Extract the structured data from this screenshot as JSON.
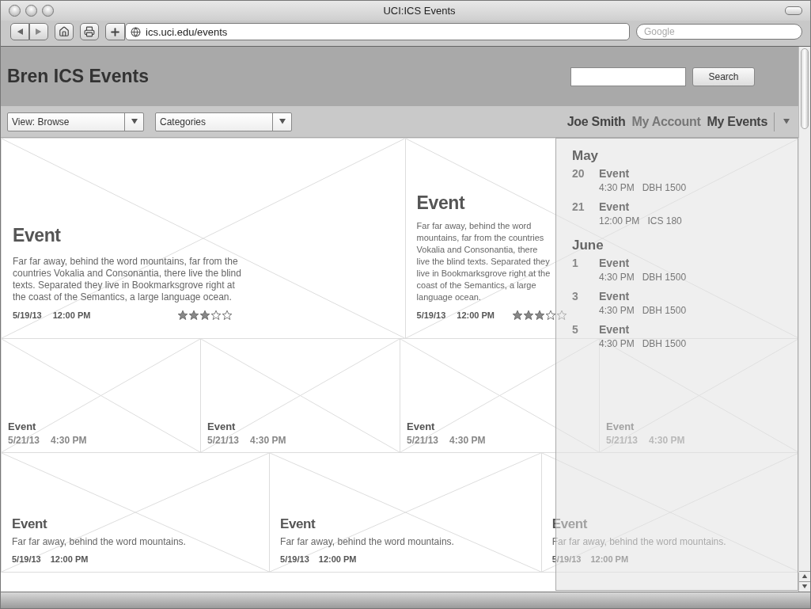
{
  "browser": {
    "title": "UCI:ICS Events",
    "url": "ics.uci.edu/events",
    "search_placeholder": "Google"
  },
  "header": {
    "site_title": "Bren ICS Events",
    "search_button": "Search"
  },
  "nav": {
    "dropdowns": [
      {
        "label": "View: Browse"
      },
      {
        "label": "Categories"
      }
    ],
    "user_name": "Joe Smith",
    "links": [
      {
        "label": "My Account",
        "selected": false
      },
      {
        "label": "My Events",
        "selected": true
      }
    ]
  },
  "events_grid": {
    "rows": [
      {
        "kind": "large",
        "tiles": [
          {
            "title": "Event",
            "description": "Far far away, behind the word mountains, far from the countries Vokalia and Consonantia, there live the blind texts. Separated they live in Bookmarksgrove right at the coast of the Semantics, a large language ocean.",
            "date": "5/19/13",
            "time": "12:00 PM",
            "stars": 3
          },
          {
            "title": "Event",
            "description": "Far far away, behind the word mountains, far from the countries Vokalia and Consonantia, there live the blind texts. Separated they live in Bookmarksgrove right at the coast of the Semantics, a large language ocean.",
            "date": "5/19/13",
            "time": "12:00 PM",
            "stars": 3
          }
        ]
      },
      {
        "kind": "small",
        "tiles": [
          {
            "title": "Event",
            "date": "5/21/13",
            "time": "4:30 PM"
          },
          {
            "title": "Event",
            "date": "5/21/13",
            "time": "4:30 PM"
          },
          {
            "title": "Event",
            "date": "5/21/13",
            "time": "4:30 PM"
          },
          {
            "title": "Event",
            "date": "5/21/13",
            "time": "4:30 PM"
          }
        ]
      },
      {
        "kind": "medium",
        "tiles": [
          {
            "title": "Event",
            "description": "Far far away, behind the word mountains.",
            "date": "5/19/13",
            "time": "12:00 PM"
          },
          {
            "title": "Event",
            "description": "Far far away, behind the word mountains.",
            "date": "5/19/13",
            "time": "12:00 PM"
          },
          {
            "title": "Event",
            "description": "Far far away, behind the word mountains.",
            "date": "5/19/13",
            "time": "12:00 PM"
          }
        ]
      }
    ]
  },
  "my_events_menu": {
    "months": [
      {
        "name": "May",
        "events": [
          {
            "day": "20",
            "title": "Event",
            "time": "4:30 PM",
            "location": "DBH 1500"
          },
          {
            "day": "21",
            "title": "Event",
            "time": "12:00 PM",
            "location": "ICS 180"
          }
        ]
      },
      {
        "name": "June",
        "events": [
          {
            "day": "1",
            "title": "Event",
            "time": "4:30 PM",
            "location": "DBH 1500"
          },
          {
            "day": "3",
            "title": "Event",
            "time": "4:30 PM",
            "location": "DBH 1500"
          },
          {
            "day": "5",
            "title": "Event",
            "time": "4:30 PM",
            "location": "DBH 1500"
          }
        ]
      }
    ]
  }
}
